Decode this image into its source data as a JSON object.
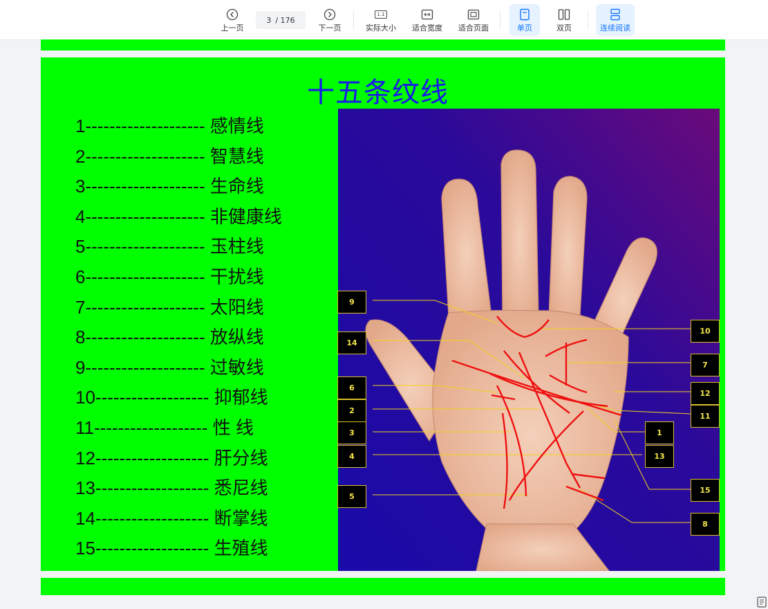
{
  "toolbar": {
    "prev_label": "上一页",
    "current_page": "3",
    "total_pages": "/ 176",
    "next_label": "下一页",
    "actual_size_label": "实际大小",
    "actual_size_icon_text": "1:1",
    "fit_width_label": "适合宽度",
    "fit_page_label": "适合页面",
    "single_page_label": "单页",
    "double_page_label": "双页",
    "continuous_label": "连续阅读",
    "accent_color": "#1677ff"
  },
  "slide": {
    "title": "十五条纹线",
    "background_color": "#00ff00",
    "title_color": "#1a1ae8",
    "items": [
      "1-------------------- 感情线",
      "2-------------------- 智慧线",
      "3-------------------- 生命线",
      "4-------------------- 非健康线",
      "5-------------------- 玉柱线",
      "6-------------------- 干扰线",
      "7-------------------- 太阳线",
      "8-------------------- 放纵线",
      "9-------------------- 过敏线",
      "10------------------- 抑郁线",
      "11------------------- 性  线",
      "12------------------- 肝分线",
      "13------------------- 悉尼线",
      "14------------------- 断掌线",
      "15------------------- 生殖线"
    ]
  },
  "palm_labels": {
    "left": [
      "9",
      "14",
      "6",
      "2",
      "3",
      "4",
      "5"
    ],
    "middle": [
      "1",
      "13"
    ],
    "right": [
      "10",
      "7",
      "12",
      "11",
      "15",
      "8"
    ]
  }
}
